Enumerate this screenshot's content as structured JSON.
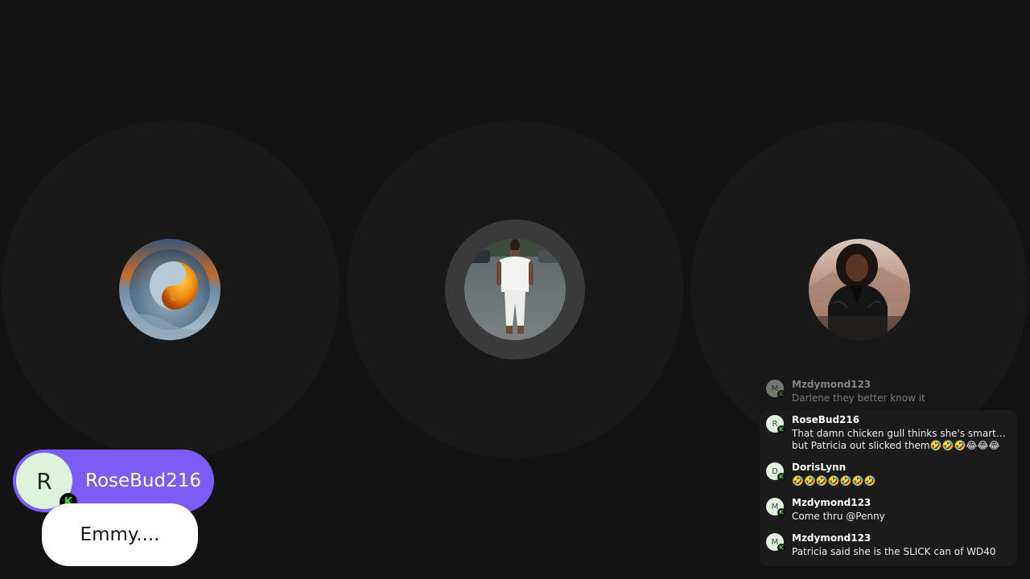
{
  "speaker": {
    "initial": "R",
    "name": "RoseBud216",
    "badge": "K",
    "caption": "Emmy...."
  },
  "participants": [
    {
      "avatar": "yin-yang-fire-water-image"
    },
    {
      "avatar": "person-in-white-outfit-photo",
      "speaking": true
    },
    {
      "avatar": "woman-in-leather-jacket-photo"
    }
  ],
  "chat": {
    "messages": [
      {
        "initial": "M",
        "user": "Mzdymond123",
        "text": "Darlene they better know it"
      },
      {
        "initial": "R",
        "user": "RoseBud216",
        "text": "That damn chicken gull thinks she's smart…but Patricia out slicked them🤣🤣🤣😂😂😂"
      },
      {
        "initial": "D",
        "user": "DorisLynn",
        "text": "🤣🤣🤣🤣🤣🤣🤣"
      },
      {
        "initial": "M",
        "user": "Mzdymond123",
        "text": "Come thru @Penny"
      },
      {
        "initial": "M",
        "user": "Mzdymond123",
        "text": "Patricia said she is the SLICK can of WD40"
      }
    ]
  },
  "colors": {
    "background": "#131313",
    "tile": "#181818",
    "speaker_pill": "#7b5cf5",
    "caption_pill": "#ffffff",
    "badge_green": "#49e22a"
  }
}
